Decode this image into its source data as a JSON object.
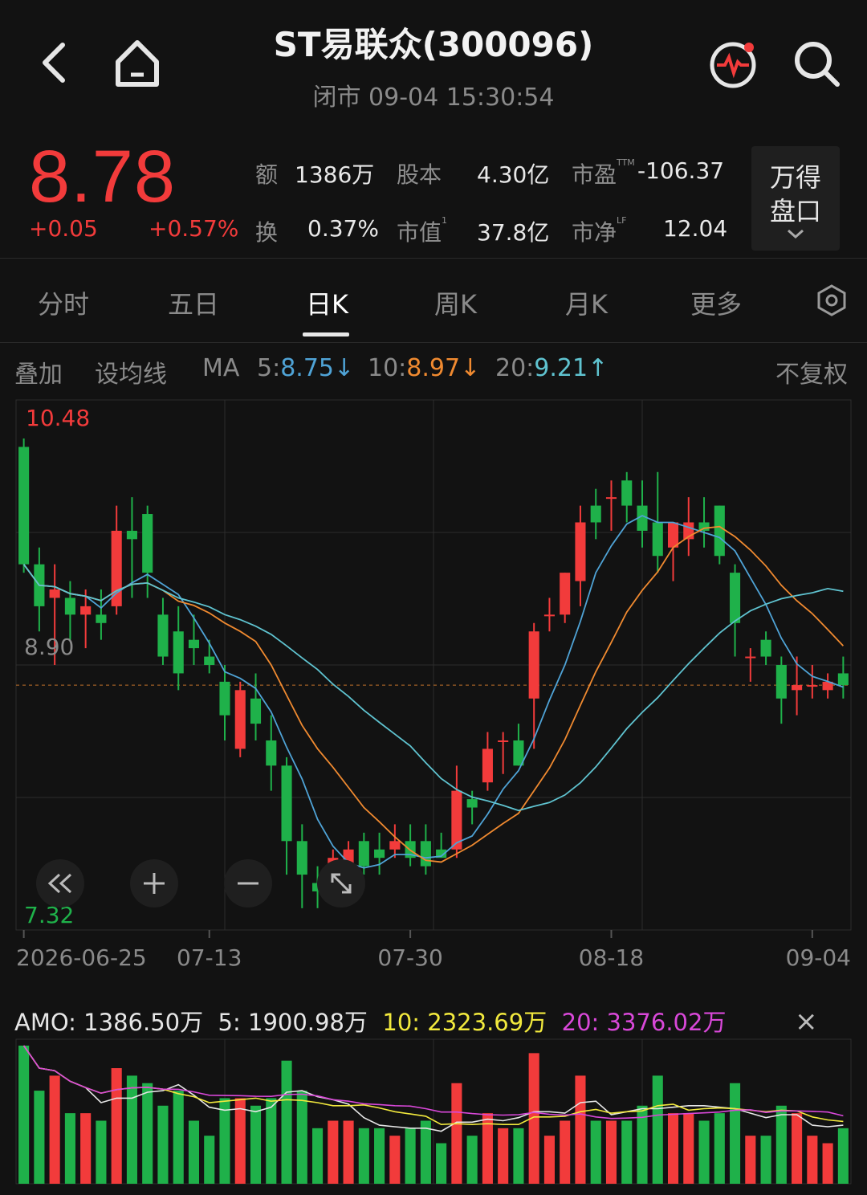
{
  "header": {
    "title": "ST易联众(300096)",
    "status": "闭市 09-04 15:30:54"
  },
  "quote": {
    "price": "8.78",
    "change": "+0.05",
    "change_pct": "+0.57%",
    "fields": [
      {
        "label": "额",
        "value": "1386万"
      },
      {
        "label": "股本",
        "value": "4.30亿"
      },
      {
        "label": "市盈",
        "sup": "TTM",
        "value": "-106.37"
      },
      {
        "label": "换",
        "value": "0.37%"
      },
      {
        "label": "市值",
        "sup": "1",
        "value": "37.8亿"
      },
      {
        "label": "市净",
        "sup": "LF",
        "value": "12.04"
      }
    ],
    "wande_line1": "万得",
    "wande_line2": "盘口"
  },
  "tabs": [
    "分时",
    "五日",
    "日K",
    "周K",
    "月K",
    "更多"
  ],
  "active_tab": "日K",
  "toolbar": {
    "overlay": "叠加",
    "set_ma": "设均线",
    "ma_label": "MA",
    "ma5_label": "5:",
    "ma5_value": "8.75",
    "ma5_arrow": "↓",
    "ma10_label": "10:",
    "ma10_value": "8.97",
    "ma10_arrow": "↓",
    "ma20_label": "20:",
    "ma20_value": "9.21",
    "ma20_arrow": "↑",
    "adjust": "不复权"
  },
  "colors": {
    "up": "#f23b3b",
    "down": "#1fb14a",
    "ma5": "#4fa3d6",
    "ma10": "#f08a30",
    "ma20": "#5fc3d0",
    "amo_ma5": "#e6e6e6",
    "amo_ma10": "#f2e93d",
    "amo_ma20": "#d948d9"
  },
  "chart_data": [
    {
      "type": "candlestick",
      "y_max_label": "10.48",
      "y_mid_label": "8.90",
      "y_min_label": "7.32",
      "ylim": [
        7.32,
        10.48
      ],
      "last_close": 8.78,
      "x_tick_labels": [
        "2026-06-25",
        "07-13",
        "07-30",
        "08-18",
        "09-04"
      ],
      "x_tick_index": [
        0,
        12,
        25,
        38,
        51
      ],
      "ohlc": [
        [
          10.2,
          10.25,
          9.45,
          9.5
        ],
        [
          9.5,
          9.6,
          9.1,
          9.25
        ],
        [
          9.3,
          9.5,
          8.9,
          9.35
        ],
        [
          9.3,
          9.4,
          9.05,
          9.2
        ],
        [
          9.2,
          9.35,
          9.0,
          9.25
        ],
        [
          9.2,
          9.35,
          9.05,
          9.15
        ],
        [
          9.25,
          9.85,
          9.2,
          9.7
        ],
        [
          9.7,
          9.9,
          9.3,
          9.65
        ],
        [
          9.8,
          9.85,
          9.3,
          9.45
        ],
        [
          9.2,
          9.3,
          8.9,
          8.95
        ],
        [
          9.1,
          9.25,
          8.75,
          8.85
        ],
        [
          9.05,
          9.2,
          8.9,
          9.0
        ],
        [
          8.95,
          9.05,
          8.85,
          8.9
        ],
        [
          8.8,
          8.9,
          8.45,
          8.6
        ],
        [
          8.4,
          8.8,
          8.35,
          8.75
        ],
        [
          8.7,
          8.85,
          8.45,
          8.55
        ],
        [
          8.45,
          8.6,
          8.15,
          8.3
        ],
        [
          8.3,
          8.35,
          7.65,
          7.85
        ],
        [
          7.85,
          7.95,
          7.45,
          7.65
        ],
        [
          7.6,
          7.7,
          7.45,
          7.55
        ],
        [
          7.6,
          7.8,
          7.5,
          7.75
        ],
        [
          7.6,
          7.85,
          7.55,
          7.8
        ],
        [
          7.85,
          7.9,
          7.65,
          7.7
        ],
        [
          7.8,
          7.9,
          7.65,
          7.75
        ],
        [
          7.8,
          7.95,
          7.75,
          7.85
        ],
        [
          7.85,
          7.95,
          7.7,
          7.75
        ],
        [
          7.85,
          7.95,
          7.65,
          7.7
        ],
        [
          7.8,
          7.9,
          7.75,
          7.75
        ],
        [
          7.8,
          8.3,
          7.75,
          8.15
        ],
        [
          8.1,
          8.15,
          7.95,
          8.05
        ],
        [
          8.2,
          8.5,
          8.15,
          8.4
        ],
        [
          8.45,
          8.5,
          8.25,
          8.45
        ],
        [
          8.45,
          8.55,
          8.3,
          8.3
        ],
        [
          8.7,
          9.15,
          8.4,
          9.1
        ],
        [
          9.2,
          9.3,
          9.1,
          9.2
        ],
        [
          9.2,
          9.45,
          9.15,
          9.45
        ],
        [
          9.4,
          9.85,
          9.25,
          9.75
        ],
        [
          9.85,
          9.95,
          9.65,
          9.75
        ],
        [
          9.9,
          10.0,
          9.7,
          9.9
        ],
        [
          10.0,
          10.05,
          9.75,
          9.85
        ],
        [
          9.85,
          10.0,
          9.6,
          9.7
        ],
        [
          9.75,
          10.05,
          9.45,
          9.55
        ],
        [
          9.6,
          9.75,
          9.4,
          9.75
        ],
        [
          9.65,
          9.9,
          9.55,
          9.75
        ],
        [
          9.75,
          9.9,
          9.6,
          9.7
        ],
        [
          9.85,
          9.85,
          9.5,
          9.55
        ],
        [
          9.45,
          9.5,
          8.95,
          9.15
        ],
        [
          8.95,
          9.0,
          8.8,
          8.95
        ],
        [
          9.05,
          9.1,
          8.9,
          8.95
        ],
        [
          8.9,
          8.95,
          8.55,
          8.7
        ],
        [
          8.75,
          8.95,
          8.6,
          8.78
        ],
        [
          8.78,
          8.9,
          8.7,
          8.78
        ],
        [
          8.75,
          8.85,
          8.7,
          8.8
        ],
        [
          8.85,
          8.95,
          8.7,
          8.78
        ]
      ]
    },
    {
      "type": "bar",
      "title": "AMO",
      "legend": [
        {
          "label": "AMO:",
          "value": "1386.50万"
        },
        {
          "label": "5:",
          "value": "1900.98万"
        },
        {
          "label": "10:",
          "value": "2323.69万"
        },
        {
          "label": "20:",
          "value": "3376.02万"
        }
      ],
      "close_label": "×"
    }
  ]
}
